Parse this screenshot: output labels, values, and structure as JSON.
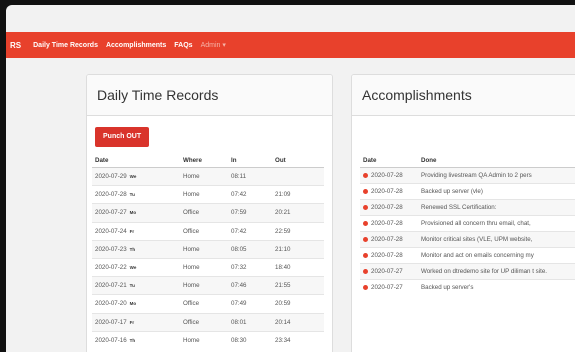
{
  "navbar": {
    "brand": "RS",
    "links": [
      "Daily Time Records",
      "Accomplishments",
      "FAQs"
    ],
    "admin": "Admin ▾"
  },
  "dtr": {
    "title": "Daily Time Records",
    "punch_label": "Punch OUT",
    "columns": [
      "Date",
      "Where",
      "In",
      "Out"
    ],
    "rows": [
      {
        "date": "2020-07-29",
        "day": "We",
        "where": "Home",
        "in": "08:11",
        "out": ""
      },
      {
        "date": "2020-07-28",
        "day": "Tu",
        "where": "Home",
        "in": "07:42",
        "out": "21:09"
      },
      {
        "date": "2020-07-27",
        "day": "Mo",
        "where": "Office",
        "in": "07:59",
        "out": "20:21"
      },
      {
        "date": "2020-07-24",
        "day": "Fr",
        "where": "Office",
        "in": "07:42",
        "out": "22:59"
      },
      {
        "date": "2020-07-23",
        "day": "Th",
        "where": "Home",
        "in": "08:05",
        "out": "21:10"
      },
      {
        "date": "2020-07-22",
        "day": "We",
        "where": "Home",
        "in": "07:32",
        "out": "18:40"
      },
      {
        "date": "2020-07-21",
        "day": "Tu",
        "where": "Home",
        "in": "07:46",
        "out": "21:55"
      },
      {
        "date": "2020-07-20",
        "day": "Mo",
        "where": "Office",
        "in": "07:49",
        "out": "20:59"
      },
      {
        "date": "2020-07-17",
        "day": "Fr",
        "where": "Office",
        "in": "08:01",
        "out": "20:14"
      },
      {
        "date": "2020-07-16",
        "day": "Th",
        "where": "Home",
        "in": "08:30",
        "out": "23:34"
      }
    ]
  },
  "acc": {
    "title": "Accomplishments",
    "columns": [
      "Date",
      "Done"
    ],
    "rows": [
      {
        "date": "2020-07-28",
        "done": "Providing livestream QA Admin to 2 pers"
      },
      {
        "date": "2020-07-28",
        "done": "Backed up server (vle)"
      },
      {
        "date": "2020-07-28",
        "done": "Renewed SSL Certification:"
      },
      {
        "date": "2020-07-28",
        "done": "Provisioned all concern thru email, chat,"
      },
      {
        "date": "2020-07-28",
        "done": "Monitor critical sites (VLE, UPM website,"
      },
      {
        "date": "2020-07-28",
        "done": "Monitor and act on emails concerning my"
      },
      {
        "date": "2020-07-27",
        "done": "Worked on dtredemo site for UP diliman t site."
      },
      {
        "date": "2020-07-27",
        "done": "Backed up server's"
      }
    ]
  },
  "colors": {
    "accent": "#e8412c",
    "button": "#d9342b"
  }
}
